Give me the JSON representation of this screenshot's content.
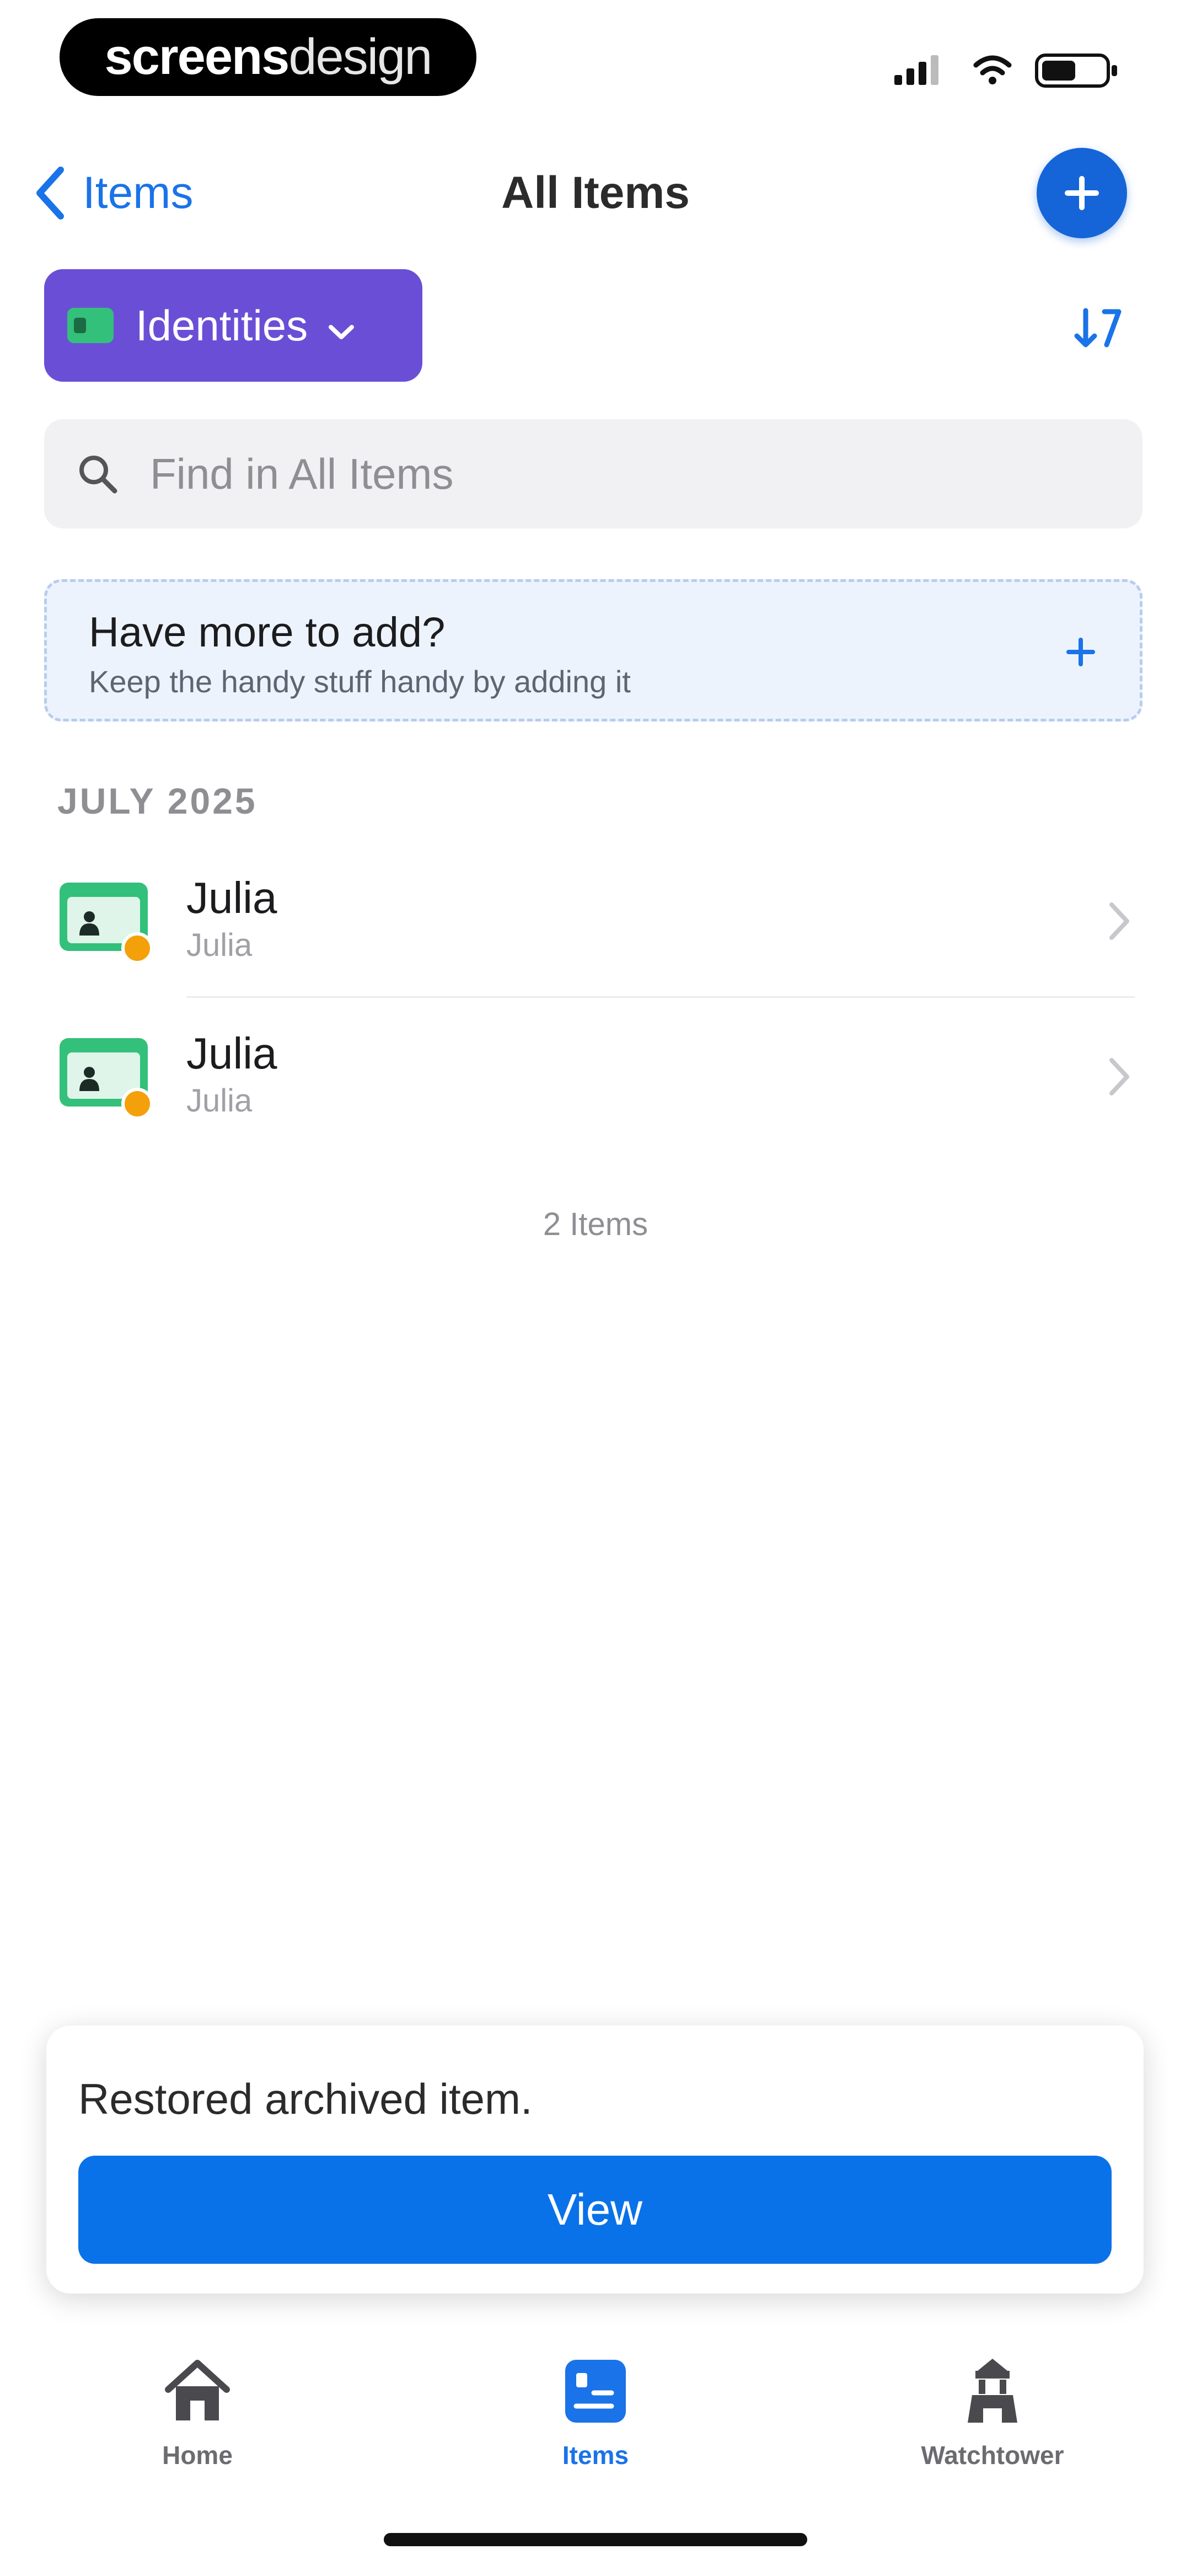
{
  "brand": {
    "part1": "screens",
    "part2": "design"
  },
  "nav": {
    "back_label": "Items",
    "title": "All Items"
  },
  "filter": {
    "label": "Identities"
  },
  "search": {
    "placeholder": "Find in All Items"
  },
  "promo": {
    "title": "Have more to add?",
    "subtitle": "Keep the handy stuff handy by adding it"
  },
  "section": {
    "header": "JULY 2025"
  },
  "items": [
    {
      "name": "Julia",
      "subtitle": "Julia"
    },
    {
      "name": "Julia",
      "subtitle": "Julia"
    }
  ],
  "item_count": "2 Items",
  "toast": {
    "message": "Restored archived item.",
    "button_label": "View"
  },
  "tabs": [
    {
      "label": "Home",
      "icon": "home-icon",
      "active": false
    },
    {
      "label": "Items",
      "icon": "items-icon",
      "active": true
    },
    {
      "label": "Watchtower",
      "icon": "watchtower-icon",
      "active": false
    }
  ],
  "colors": {
    "accent": "#1a73e8",
    "filter_chip": "#6a4fd6",
    "identity_green": "#33c07a",
    "badge_orange": "#f4a00a",
    "view_button": "#0a72e8"
  }
}
